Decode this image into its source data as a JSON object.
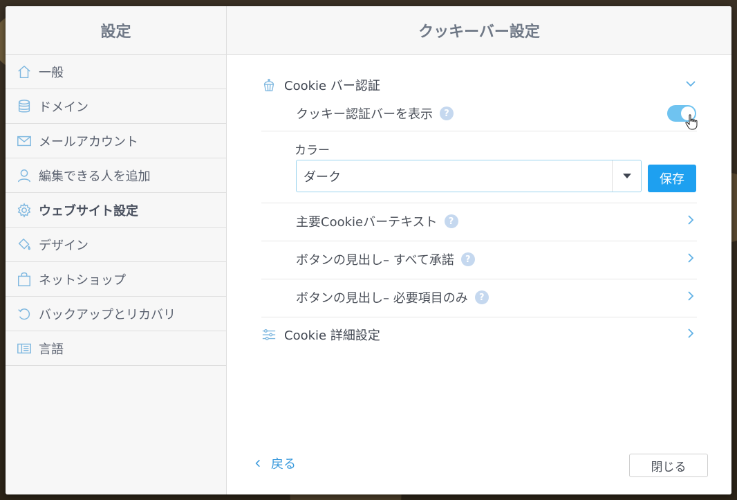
{
  "sidebar": {
    "title": "設定",
    "items": [
      {
        "label": "一般",
        "icon": "home-icon"
      },
      {
        "label": "ドメイン",
        "icon": "database-icon"
      },
      {
        "label": "メールアカウント",
        "icon": "mail-icon"
      },
      {
        "label": "編集できる人を追加",
        "icon": "user-icon"
      },
      {
        "label": "ウェブサイト設定",
        "icon": "gear-icon",
        "active": true
      },
      {
        "label": "デザイン",
        "icon": "paint-bucket-icon"
      },
      {
        "label": "ネットショップ",
        "icon": "shopping-bag-icon"
      },
      {
        "label": "バックアップとリカバリ",
        "icon": "restore-icon"
      },
      {
        "label": "言語",
        "icon": "language-icon"
      }
    ]
  },
  "main": {
    "title": "クッキーバー設定",
    "cookie_section": {
      "title": "Cookie バー認証",
      "icon": "cupcake-icon",
      "show_bar_label": "クッキー認証バーを表示",
      "show_bar_enabled": true,
      "help": "?",
      "color_label": "カラー",
      "color_value": "ダーク",
      "save_label": "保存"
    },
    "rows": [
      {
        "label": "主要Cookieバーテキスト",
        "help": "?"
      },
      {
        "label": "ボタンの見出し– すべて承諾",
        "help": "?"
      },
      {
        "label": "ボタンの見出し– 必要項目のみ",
        "help": "?"
      }
    ],
    "advanced": {
      "title": "Cookie 詳細設定",
      "icon": "sliders-icon"
    },
    "footer": {
      "back_label": "戻る",
      "close_label": "閉じる"
    }
  },
  "colors": {
    "accent": "#1ea0f0",
    "toggle_on": "#6fc3f0",
    "help_badge": "#c5d8ef"
  }
}
